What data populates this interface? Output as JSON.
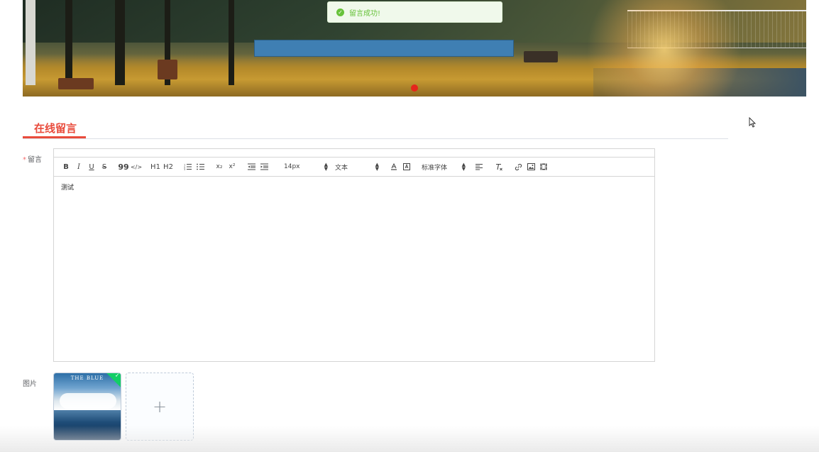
{
  "toast": {
    "message": "留言成功!",
    "status_color": "#67c23a"
  },
  "section": {
    "title": "在线留言",
    "accent_color": "#e94b3c"
  },
  "form": {
    "message_label": "留言",
    "required_mark": "*",
    "image_label": "图片"
  },
  "toolbar": {
    "bold": "B",
    "italic": "I",
    "underline": "U",
    "strike": "S",
    "blockquote": "99",
    "code": "</>",
    "h1": "H1",
    "h2": "H2",
    "subscript": "x₂",
    "superscript": "x²",
    "size_value": "14px",
    "header_value": "文本",
    "font_value": "标准字体",
    "icons": [
      "ordered-list-icon",
      "bullet-list-icon",
      "outdent-icon",
      "indent-icon",
      "font-color-icon",
      "background-color-icon",
      "align-icon",
      "clean-format-icon",
      "link-icon",
      "image-icon",
      "video-icon"
    ]
  },
  "editor": {
    "content": "测试"
  },
  "upload": {
    "thumbnail_title": "THE BLUE",
    "add_symbol": "+"
  }
}
